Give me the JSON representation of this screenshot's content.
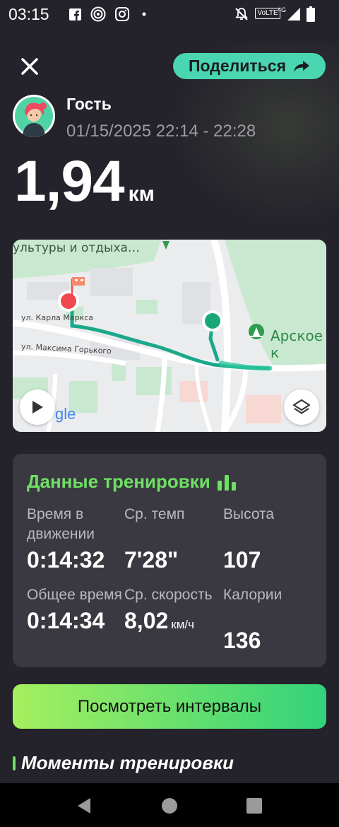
{
  "status_bar": {
    "time": "03:15",
    "dot": "•",
    "icons": [
      "facebook-icon",
      "podcast-icon",
      "instagram-icon",
      "mute-icon",
      "volte-icon",
      "signal-icon",
      "battery-icon"
    ],
    "volte_text": "VoLTE",
    "network": "4G"
  },
  "header": {
    "share_label": "Поделиться",
    "user_name": "Гость",
    "date_range": "01/15/2025 22:14 - 22:28"
  },
  "distance": {
    "value": "1,94",
    "unit": "км"
  },
  "map": {
    "labels": {
      "park_top": "ультуры и отдыха…",
      "street1": "ул. Карла Маркса",
      "street2": "ул. Максима Горького",
      "place": "Арское к",
      "logo_part": "gle"
    }
  },
  "workout": {
    "title": "Данные тренировки",
    "stats": [
      {
        "label": "Время в движении",
        "value": "0:14:32"
      },
      {
        "label": "Ср. темп",
        "value": "7'28\""
      },
      {
        "label": "Высота",
        "value": "107"
      },
      {
        "label": "Общее время",
        "value": "0:14:34"
      },
      {
        "label": "Ср. скорость",
        "value": "8,02",
        "unit": "км/ч"
      },
      {
        "label": "Калории",
        "value": "136"
      }
    ]
  },
  "intervals_button": "Посмотреть интервалы",
  "moments_title": "Моменты тренировки",
  "colors": {
    "background": "#24232b",
    "accent_green": "#6ee063",
    "share_button": "#4ad6b0",
    "route": "#1aa88a",
    "card": "#3a3941"
  }
}
